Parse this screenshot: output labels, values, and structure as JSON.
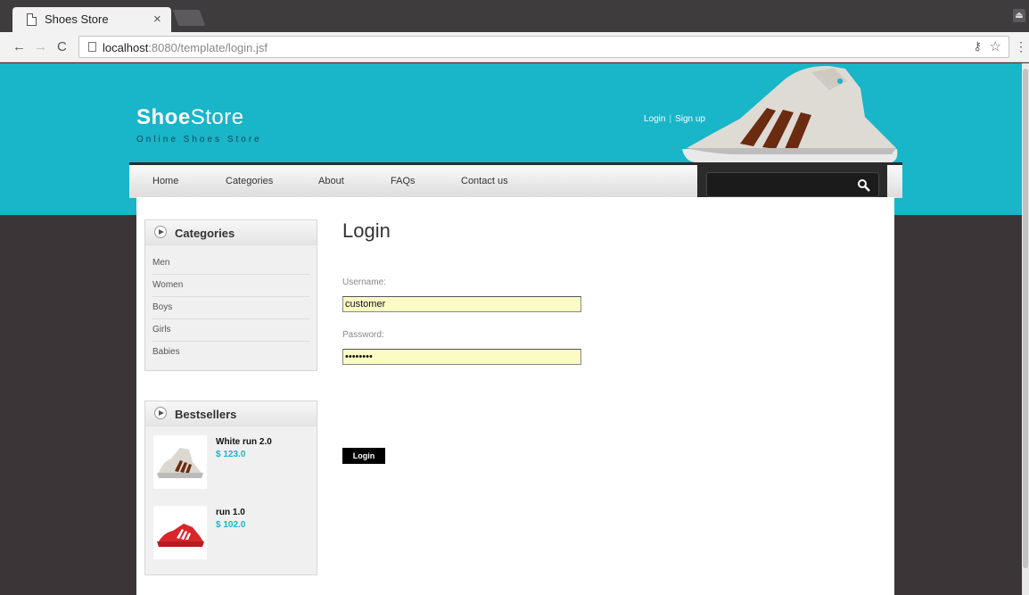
{
  "browser": {
    "tab_title": "Shoes Store",
    "tab_close": "×",
    "url_host": "localhost",
    "url_rest": ":8080/template/login.jsf",
    "profile_glyph": "⏏"
  },
  "header": {
    "logo_bold": "Shoe",
    "logo_light": "Store",
    "tagline": "Online Shoes Store",
    "login_link": "Login",
    "signup_link": "Sign up",
    "separator": "|"
  },
  "nav": {
    "items": [
      "Home",
      "Categories",
      "About",
      "FAQs",
      "Contact us"
    ]
  },
  "sidebar": {
    "categories_title": "Categories",
    "categories": [
      "Men",
      "Women",
      "Boys",
      "Girls",
      "Babies"
    ],
    "bestsellers_title": "Bestsellers",
    "bestsellers": [
      {
        "name": "White run 2.0",
        "price": "$ 123.0"
      },
      {
        "name": "run 1.0",
        "price": "$ 102.0"
      }
    ]
  },
  "login": {
    "title": "Login",
    "username_label": "Username:",
    "username_value": "customer",
    "password_label": "Password:",
    "password_value": "password",
    "button_label": "Login"
  },
  "colors": {
    "accent": "#19b5c8",
    "background": "#3c3538",
    "input_bg": "#fbfbc6"
  }
}
